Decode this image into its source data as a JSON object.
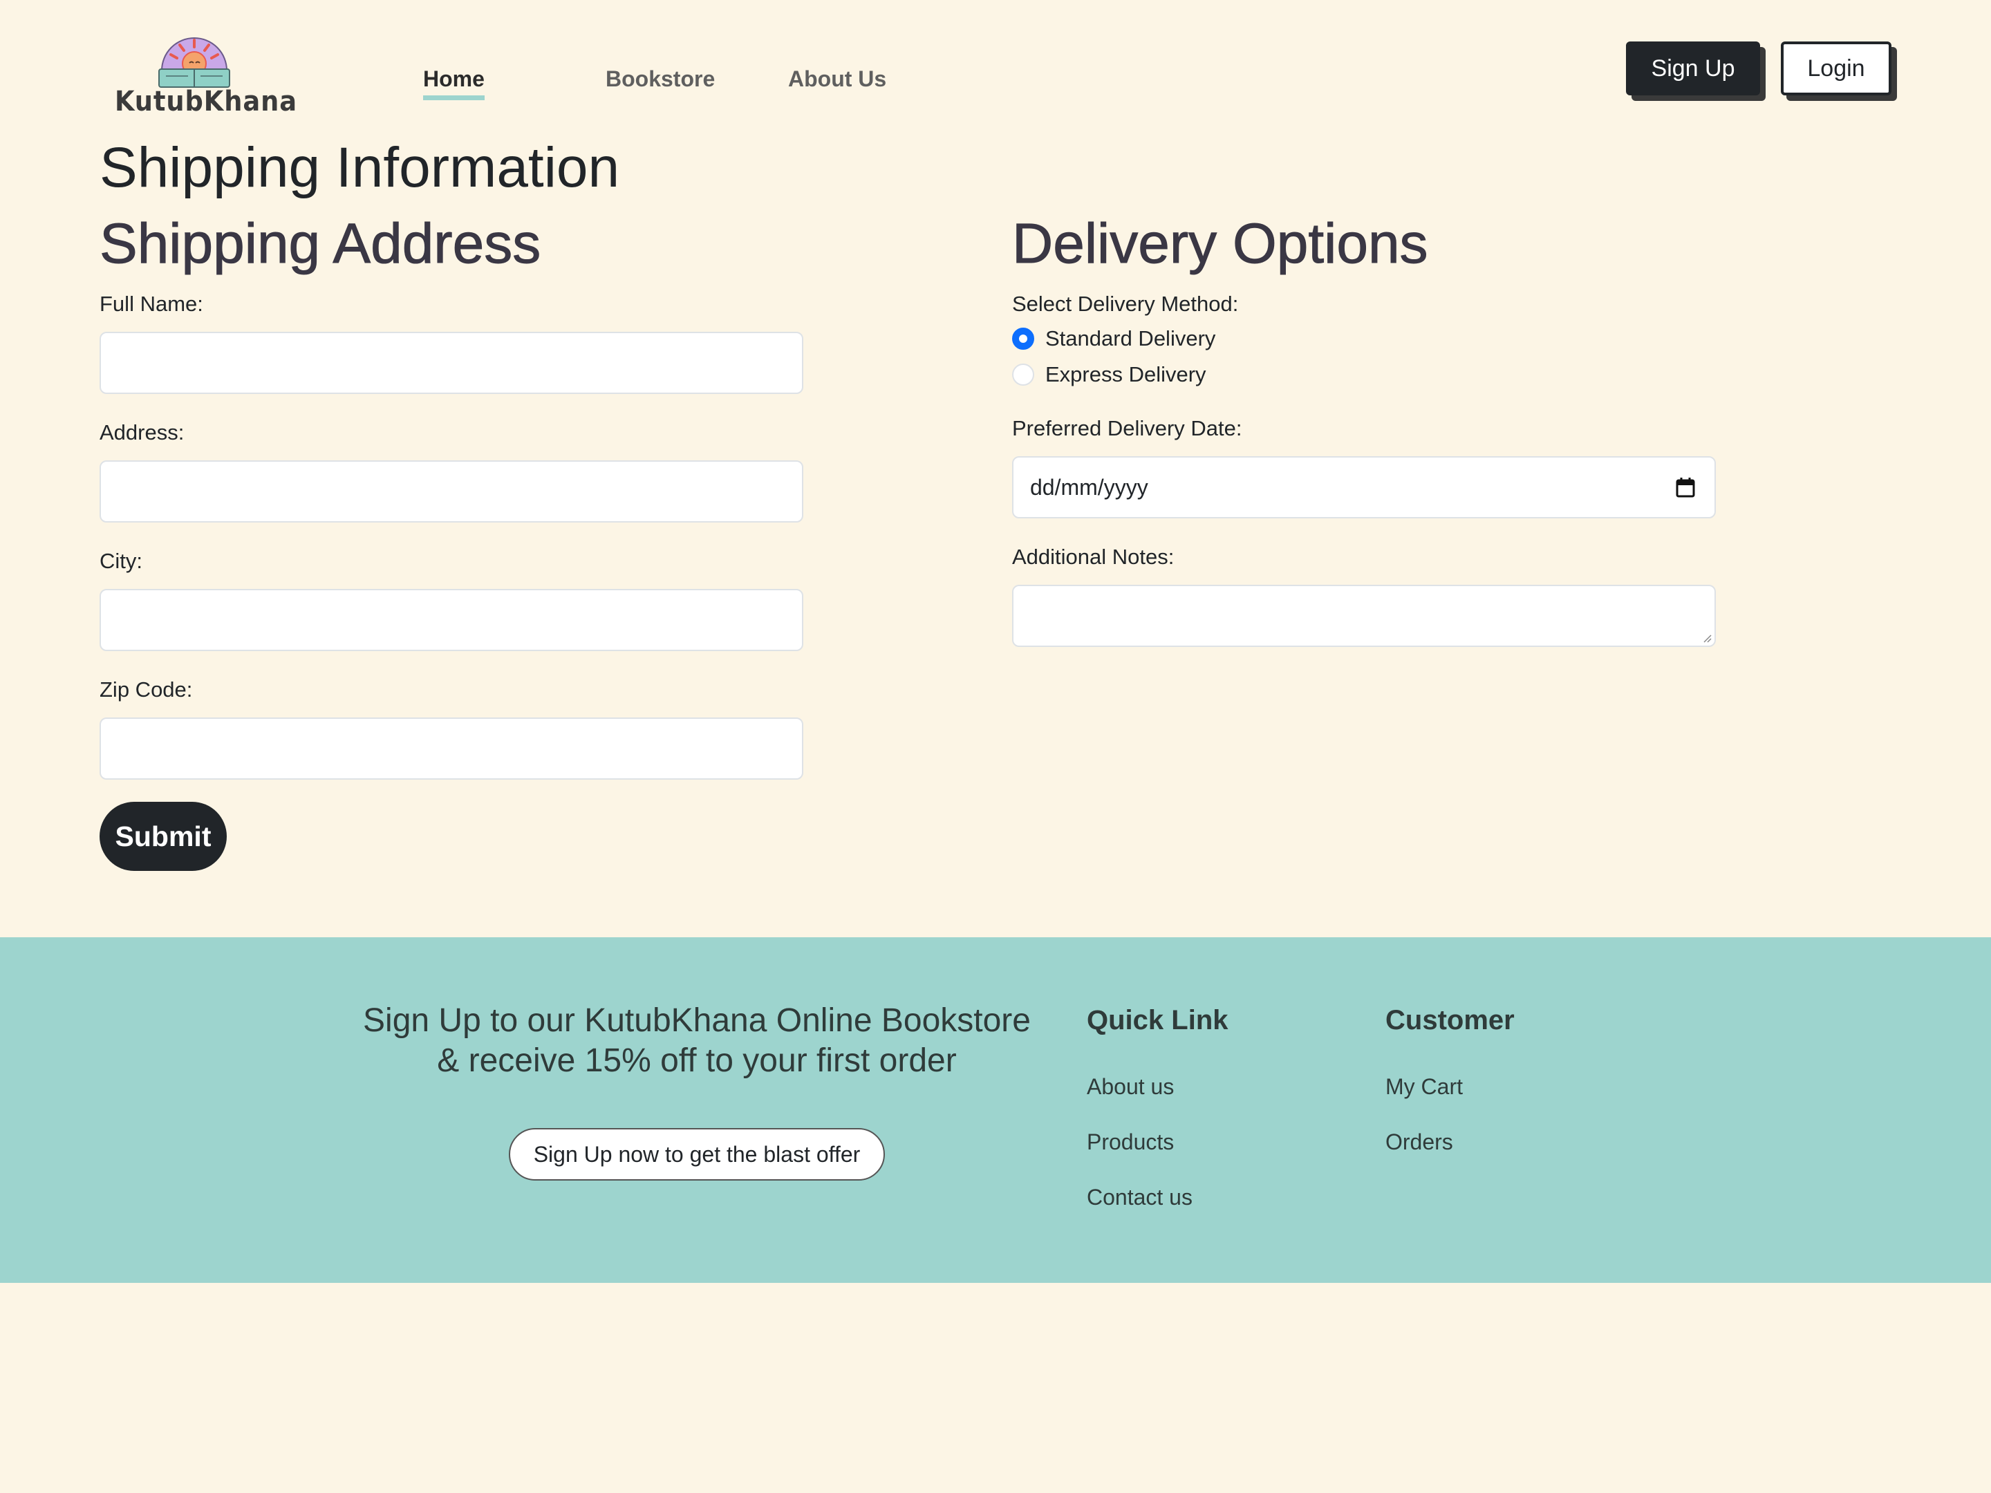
{
  "header": {
    "logo_text": "KutubKhana",
    "nav": {
      "home": "Home",
      "bookstore": "Bookstore",
      "about": "About Us"
    },
    "signup_label": "Sign Up",
    "login_label": "Login"
  },
  "main": {
    "page_title": "Shipping Information",
    "shipping": {
      "title": "Shipping Address",
      "full_name_label": "Full Name:",
      "full_name_value": "",
      "address_label": "Address:",
      "address_value": "",
      "city_label": "City:",
      "city_value": "",
      "zip_label": "Zip Code:",
      "zip_value": "",
      "submit_label": "Submit"
    },
    "delivery": {
      "title": "Delivery Options",
      "method_label": "Select Delivery Method:",
      "options": [
        {
          "label": "Standard Delivery",
          "checked": true
        },
        {
          "label": "Express Delivery",
          "checked": false
        }
      ],
      "date_label": "Preferred Delivery Date:",
      "date_placeholder": "dd/mm/yyyy",
      "notes_label": "Additional Notes:",
      "notes_value": ""
    }
  },
  "footer": {
    "promo_line1": "Sign Up to our KutubKhana Online Bookstore",
    "promo_line2": "& receive 15% off to your first order",
    "promo_button": "Sign Up now to get the blast offer",
    "quick_link": {
      "heading": "Quick Link",
      "links": [
        "About us",
        "Products",
        "Contact us"
      ]
    },
    "customer": {
      "heading": "Customer",
      "links": [
        "My Cart",
        "Orders"
      ]
    }
  },
  "colors": {
    "page_background": "#fcf5e5",
    "footer_background": "#9dd4ce",
    "dark_button": "#212529",
    "radio_accent": "#0d6efd",
    "nav_underline": "#9dd4ce"
  },
  "icons": {
    "logo": "reading-sun-logo",
    "date_picker": "calendar-icon"
  }
}
